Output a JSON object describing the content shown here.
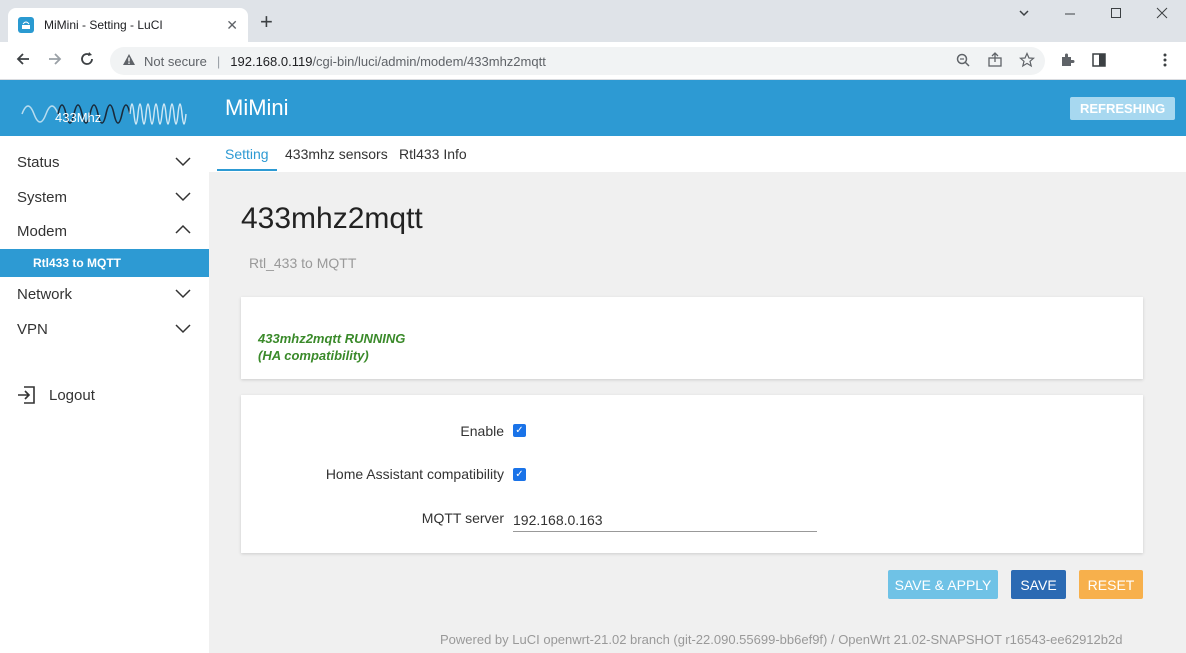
{
  "browser": {
    "tab_title": "MiMini - Setting - LuCI",
    "tab_close": "✕",
    "new_tab": "+",
    "address": {
      "security_label": "Not secure",
      "host": "192.168.0.119",
      "path": "/cgi-bin/luci/admin/modem/433mhz2mqtt"
    },
    "icons": [
      "back-icon",
      "forward-icon",
      "reload-icon",
      "warning-icon",
      "zoom-icon",
      "share-icon",
      "star-icon",
      "extensions-icon",
      "sidepanel-icon",
      "menu-icon"
    ]
  },
  "header": {
    "brand": "MiMini",
    "logo_text": "433Mhz",
    "refresh_label": "REFRESHING"
  },
  "sidebar": {
    "items": [
      {
        "label": "Status",
        "expanded": false
      },
      {
        "label": "System",
        "expanded": false
      },
      {
        "label": "Modem",
        "expanded": true
      },
      {
        "label": "Network",
        "expanded": false
      },
      {
        "label": "VPN",
        "expanded": false
      }
    ],
    "sub_item": "Rtl433 to MQTT",
    "logout": "Logout"
  },
  "tabs": [
    {
      "label": "Setting",
      "active": true
    },
    {
      "label": "433mhz sensors",
      "active": false
    },
    {
      "label": "Rtl433 Info",
      "active": false
    }
  ],
  "page": {
    "title": "433mhz2mqtt",
    "description": "Rtl_433 to MQTT"
  },
  "status": {
    "line1": "433mhz2mqtt RUNNING",
    "line2": "(HA compatibility)"
  },
  "form": {
    "enable_label": "Enable",
    "enable_checked": true,
    "ha_label": "Home Assistant compatibility",
    "ha_checked": true,
    "mqtt_label": "MQTT server",
    "mqtt_value": "192.168.0.163"
  },
  "buttons": {
    "save_apply": "SAVE & APPLY",
    "save": "SAVE",
    "reset": "RESET"
  },
  "footer": "Powered by LuCI openwrt-21.02 branch (git-22.090.55699-bb6ef9f) / OpenWrt 21.02-SNAPSHOT r16543-ee62912b2d",
  "colors": {
    "accent": "#2d9ad3",
    "status_green": "#3a8a2a",
    "apply": "#6fc2e6",
    "save": "#2b6ab3",
    "reset": "#f7b04c"
  }
}
